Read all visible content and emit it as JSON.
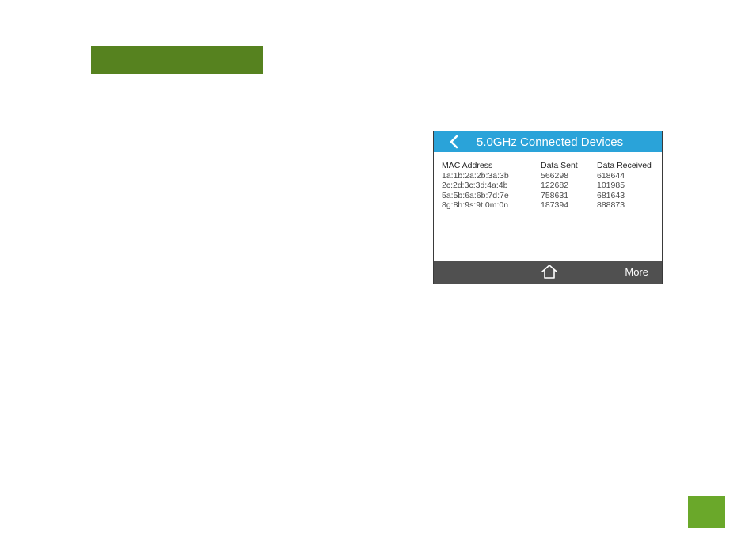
{
  "colors": {
    "header_tab": "#56821f",
    "page_corner": "#6aa82a",
    "titlebar": "#2aa3d9",
    "footer": "#505050"
  },
  "screen": {
    "title": "5.0GHz Connected Devices",
    "back_icon": "chevron-left-icon",
    "table": {
      "headers": {
        "mac": "MAC Address",
        "sent": "Data Sent",
        "received": "Data Received"
      },
      "rows": [
        {
          "mac": "1a:1b:2a:2b:3a:3b",
          "sent": "566298",
          "received": "618644"
        },
        {
          "mac": "2c:2d:3c:3d:4a:4b",
          "sent": "122682",
          "received": "101985"
        },
        {
          "mac": "5a:5b:6a:6b:7d:7e",
          "sent": "758631",
          "received": "681643"
        },
        {
          "mac": "8g:8h:9s:9t:0m:0n",
          "sent": "187394",
          "received": "888873"
        }
      ]
    },
    "footer": {
      "home_icon": "home-icon",
      "more_label": "More"
    }
  }
}
